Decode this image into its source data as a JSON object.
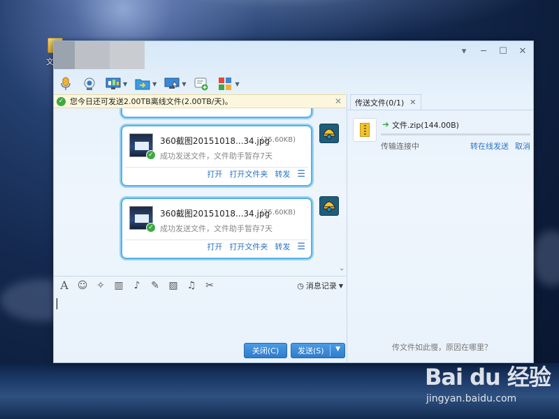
{
  "desktop": {
    "folder_label": "文"
  },
  "window": {
    "controls": {
      "menu": "▾",
      "minimize": "─",
      "maximize": "☐",
      "close": "✕"
    }
  },
  "toolbar": {
    "items": [
      {
        "icon": "microphone-icon",
        "has_menu": false
      },
      {
        "icon": "webcam-icon",
        "has_menu": false
      },
      {
        "icon": "screen-share-icon",
        "has_menu": true
      },
      {
        "icon": "send-file-icon",
        "has_menu": true
      },
      {
        "icon": "remote-assist-icon",
        "has_menu": true
      },
      {
        "icon": "add-app-icon",
        "has_menu": false
      },
      {
        "icon": "apps-grid-icon",
        "has_menu": true
      }
    ]
  },
  "notice": {
    "text": "您今日还可发送2.00TB离线文件(2.00TB/天)。",
    "close": "✕"
  },
  "messages": [
    {
      "file_name": "360截图20151018...34.jpg",
      "file_size": "(35.60KB)",
      "status": "成功发送文件，文件助手暂存7天",
      "actions": {
        "open": "打开",
        "open_folder": "打开文件夹",
        "forward": "转发"
      }
    },
    {
      "file_name": "360截图20151018...34.jpg",
      "file_size": "(35.60KB)",
      "status": "成功发送文件，文件助手暂存7天",
      "actions": {
        "open": "打开",
        "open_folder": "打开文件夹",
        "forward": "转发"
      }
    }
  ],
  "input_toolbar": {
    "history_label": "消息记录"
  },
  "buttons": {
    "close": "关闭(C)",
    "send": "发送(S)"
  },
  "right_panel": {
    "tab_label": "传送文件(0/1)",
    "file_name": "文件.zip(144.00B)",
    "progress_fraction": 0.0,
    "status": "传输连接中",
    "switch_online": "转在线发送",
    "cancel": "取消",
    "hint": "传文件如此慢，原因在哪里？"
  },
  "watermark": {
    "brand": "Bai du 经验",
    "url": "jingyan.baidu.com"
  },
  "colors": {
    "accent": "#2a73c5",
    "bubble_border": "#56b1e8",
    "success": "#3fa842",
    "notice_bg": "#fcf7dc"
  }
}
